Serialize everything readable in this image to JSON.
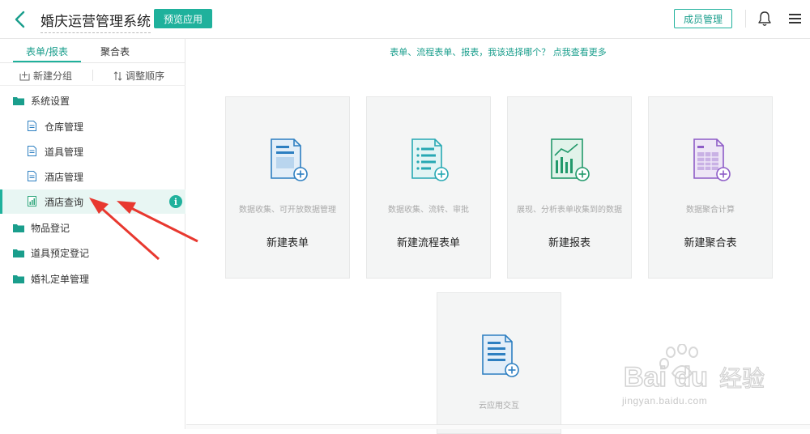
{
  "header": {
    "title": "婚庆运营管理系统",
    "preview_button": "预览应用",
    "member_button": "成员管理",
    "icons": [
      "back-icon",
      "bell-icon",
      "menu-icon"
    ]
  },
  "colors": {
    "accent": "#1fb19c",
    "arrow": "#e8382f"
  },
  "sidebar": {
    "tabs": [
      {
        "label": "表单/报表",
        "active": true
      },
      {
        "label": "聚合表",
        "active": false
      }
    ],
    "toolbar": {
      "new_group": "新建分组",
      "reorder": "调整顺序"
    },
    "tree": [
      {
        "label": "系统设置",
        "type": "folder"
      },
      {
        "label": "仓库管理",
        "type": "form"
      },
      {
        "label": "道具管理",
        "type": "form"
      },
      {
        "label": "酒店管理",
        "type": "form"
      },
      {
        "label": "酒店查询",
        "type": "report",
        "active": true,
        "badge": "i"
      },
      {
        "label": "物品登记",
        "type": "folder"
      },
      {
        "label": "道具预定登记",
        "type": "folder"
      },
      {
        "label": "婚礼定单管理",
        "type": "folder"
      }
    ]
  },
  "main": {
    "hint": "表单、流程表单、报表，我该选择哪个？ 点我查看更多",
    "cards": [
      {
        "desc": "数据收集、可开放数据管理",
        "name": "新建表单",
        "icon": "form-plus-icon"
      },
      {
        "desc": "数据收集、流转、审批",
        "name": "新建流程表单",
        "icon": "flow-form-plus-icon"
      },
      {
        "desc": "展现、分析表单收集到的数据",
        "name": "新建报表",
        "icon": "report-plus-icon"
      },
      {
        "desc": "数据聚合计算",
        "name": "新建聚合表",
        "icon": "aggregate-plus-icon"
      },
      {
        "desc": "云应用交互",
        "name": "",
        "icon": "cloud-app-plus-icon"
      }
    ]
  },
  "watermark": {
    "logo": "Baidu经验",
    "url": "jingyan.baidu.com"
  }
}
